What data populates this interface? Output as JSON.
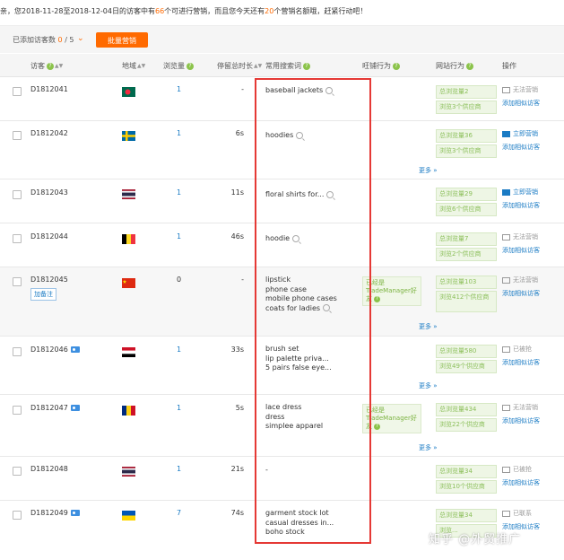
{
  "notice": {
    "part1": "亲，您2018-11-28至2018-12-04日的访客中有",
    "count1": "66",
    "part2": "个可进行营销，而且您今天还有",
    "count2": "20",
    "part3": "个营销名额哦，赶紧行动吧！"
  },
  "toolbar": {
    "added_label": "已添加访客数",
    "added_current": "0",
    "added_total": "/ 5",
    "bulk_button": "批量营销"
  },
  "columns": {
    "visitor": "访客",
    "region": "地域",
    "views": "浏览量",
    "stay": "停留总时长",
    "keywords": "常用搜索词",
    "shop_behavior": "旺铺行为",
    "site_behavior": "网站行为",
    "action": "操作"
  },
  "more_label": "更多",
  "note_button": "加备注",
  "rows": [
    {
      "id": "D1812041",
      "flag": "bd",
      "views": "1",
      "stay": "-",
      "keywords": [
        "baseball jackets"
      ],
      "site": [
        "总浏览量2",
        "浏览3个供应商"
      ],
      "action": "无法营销",
      "action_state": "disabled",
      "similar": "添加相似访客"
    },
    {
      "id": "D1812042",
      "flag": "se",
      "views": "1",
      "stay": "6s",
      "keywords": [
        "hoodies"
      ],
      "site": [
        "总浏览量36",
        "浏览3个供应商"
      ],
      "action": "立即营销",
      "action_state": "active",
      "similar": "添加相似访客"
    },
    {
      "id": "D1812043",
      "flag": "th",
      "views": "1",
      "stay": "11s",
      "keywords": [
        "floral shirts for..."
      ],
      "site": [
        "总浏览量29",
        "浏览6个供应商"
      ],
      "action": "立即营销",
      "action_state": "active",
      "similar": "添加相似访客"
    },
    {
      "id": "D1812044",
      "flag": "be",
      "views": "1",
      "stay": "46s",
      "keywords": [
        "hoodie"
      ],
      "site": [
        "总浏览量7",
        "浏览2个供应商"
      ],
      "action": "无法营销",
      "action_state": "disabled",
      "similar": "添加相似访客"
    },
    {
      "id": "D1812045",
      "flag": "cn",
      "views": "0",
      "stay": "-",
      "keywords": [
        "lipstick",
        "phone case",
        "mobile phone cases",
        "coats for ladies"
      ],
      "tm": "已经是TradeManager好友",
      "site": [
        "总浏览量103",
        "浏览412个供应商"
      ],
      "action": "无法营销",
      "action_state": "disabled",
      "similar": "添加相似访客"
    },
    {
      "id": "D1812046",
      "flag": "eg",
      "views": "1",
      "stay": "33s",
      "keywords": [
        "brush set",
        "lip palette priva...",
        "5 pairs false eye..."
      ],
      "site": [
        "总浏览量580",
        "浏览49个供应商"
      ],
      "action": "已被抢",
      "action_state": "disabled",
      "similar": "添加相似访客"
    },
    {
      "id": "D1812047",
      "flag": "ro",
      "views": "1",
      "stay": "5s",
      "keywords": [
        "lace dress",
        "dress",
        "simplee apparel"
      ],
      "tm": "已经是TradeManager好友",
      "site": [
        "总浏览量434",
        "浏览22个供应商"
      ],
      "action": "无法营销",
      "action_state": "disabled",
      "similar": "添加相似访客"
    },
    {
      "id": "D1812048",
      "flag": "th",
      "views": "1",
      "stay": "21s",
      "keywords": [
        "-"
      ],
      "site": [
        "总浏览量34",
        "浏览10个供应商"
      ],
      "action": "已被抢",
      "action_state": "disabled",
      "similar": "添加相似访客"
    },
    {
      "id": "D1812049",
      "flag": "ua",
      "views": "7",
      "stay": "74s",
      "keywords": [
        "garment stock lot",
        "casual dresses in...",
        "boho stock"
      ],
      "site": [
        "总浏览量34",
        "浏览..."
      ],
      "action": "已联系",
      "action_state": "disabled",
      "similar": "添加相似访客"
    }
  ],
  "watermark": "知乎 @外贸推广",
  "colors": {
    "accent": "#ff6a00",
    "link": "#1a7bc4",
    "green_tag": "#8bbf5a",
    "highlight_box": "#e53935"
  }
}
